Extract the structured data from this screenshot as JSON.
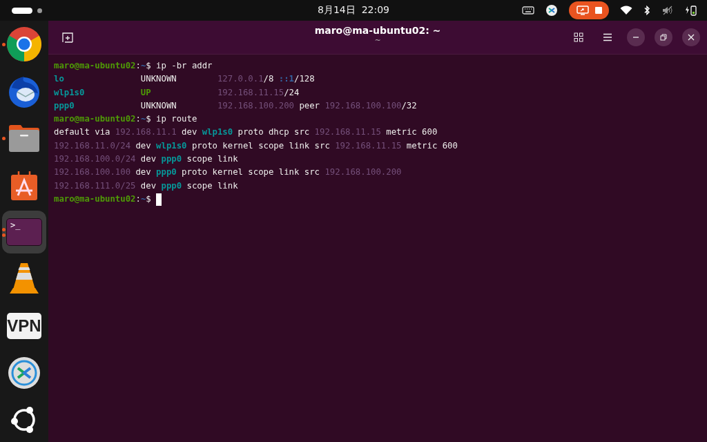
{
  "top_bar": {
    "clock": "8月14日  22:09",
    "recording": true
  },
  "dock": {
    "items": [
      {
        "kind": "chrome",
        "running": true,
        "multiple": false,
        "selected": false
      },
      {
        "kind": "mail",
        "running": false,
        "selected": false
      },
      {
        "kind": "files",
        "running": true,
        "multiple": false,
        "selected": false
      },
      {
        "kind": "store",
        "running": false,
        "selected": false
      },
      {
        "kind": "terminal",
        "running": true,
        "multiple": true,
        "selected": true,
        "icon_text": ">_"
      },
      {
        "kind": "cone",
        "running": false,
        "selected": false
      },
      {
        "kind": "vpn",
        "running": false,
        "selected": false,
        "icon_text": "VPN"
      },
      {
        "kind": "remote",
        "running": false,
        "selected": false
      },
      {
        "kind": "apps",
        "running": false,
        "selected": false
      }
    ]
  },
  "window": {
    "title": "maro@ma-ubuntu02: ~",
    "subtitle": "~"
  },
  "terminal": {
    "lines": [
      [
        {
          "text": "maro@ma-ubuntu02",
          "kind": "user"
        },
        {
          "text": ":",
          "kind": "plain"
        },
        {
          "text": "~",
          "kind": "path"
        },
        {
          "text": "$ ip -br addr",
          "kind": "plain"
        }
      ],
      [
        {
          "text": "lo               ",
          "kind": "iface"
        },
        {
          "text": "UNKNOWN        ",
          "kind": "plain"
        },
        {
          "text": "127.0.0.1",
          "kind": "addr"
        },
        {
          "text": "/8 ",
          "kind": "plain"
        },
        {
          "text": "::1",
          "kind": "addr6"
        },
        {
          "text": "/128",
          "kind": "plain"
        }
      ],
      [
        {
          "text": "wlp1s0           ",
          "kind": "iface"
        },
        {
          "text": "UP             ",
          "kind": "up"
        },
        {
          "text": "192.168.11.15",
          "kind": "addr"
        },
        {
          "text": "/24",
          "kind": "plain"
        }
      ],
      [
        {
          "text": "ppp0             ",
          "kind": "iface"
        },
        {
          "text": "UNKNOWN        ",
          "kind": "plain"
        },
        {
          "text": "192.168.100.200",
          "kind": "addr"
        },
        {
          "text": " peer ",
          "kind": "plain"
        },
        {
          "text": "192.168.100.100",
          "kind": "addr"
        },
        {
          "text": "/32",
          "kind": "plain"
        }
      ],
      [
        {
          "text": "maro@ma-ubuntu02",
          "kind": "user"
        },
        {
          "text": ":",
          "kind": "plain"
        },
        {
          "text": "~",
          "kind": "path"
        },
        {
          "text": "$ ip route",
          "kind": "plain"
        }
      ],
      [
        {
          "text": "default via ",
          "kind": "plain"
        },
        {
          "text": "192.168.11.1",
          "kind": "addr"
        },
        {
          "text": " dev ",
          "kind": "plain"
        },
        {
          "text": "wlp1s0",
          "kind": "iface"
        },
        {
          "text": " proto dhcp src ",
          "kind": "plain"
        },
        {
          "text": "192.168.11.15",
          "kind": "addr"
        },
        {
          "text": " metric 600",
          "kind": "plain"
        }
      ],
      [
        {
          "text": "192.168.11.0/24",
          "kind": "addr"
        },
        {
          "text": " dev ",
          "kind": "plain"
        },
        {
          "text": "wlp1s0",
          "kind": "iface"
        },
        {
          "text": " proto kernel scope link src ",
          "kind": "plain"
        },
        {
          "text": "192.168.11.15",
          "kind": "addr"
        },
        {
          "text": " metric 600",
          "kind": "plain"
        }
      ],
      [
        {
          "text": "192.168.100.0/24",
          "kind": "addr"
        },
        {
          "text": " dev ",
          "kind": "plain"
        },
        {
          "text": "ppp0",
          "kind": "iface"
        },
        {
          "text": " scope link",
          "kind": "plain"
        }
      ],
      [
        {
          "text": "192.168.100.100",
          "kind": "addr"
        },
        {
          "text": " dev ",
          "kind": "plain"
        },
        {
          "text": "ppp0",
          "kind": "iface"
        },
        {
          "text": " proto kernel scope link src ",
          "kind": "plain"
        },
        {
          "text": "192.168.100.200",
          "kind": "addr"
        }
      ],
      [
        {
          "text": "192.168.111.0/25",
          "kind": "addr"
        },
        {
          "text": " dev ",
          "kind": "plain"
        },
        {
          "text": "ppp0",
          "kind": "iface"
        },
        {
          "text": " scope link",
          "kind": "plain"
        }
      ],
      [
        {
          "text": "maro@ma-ubuntu02",
          "kind": "user"
        },
        {
          "text": ":",
          "kind": "plain"
        },
        {
          "text": "~",
          "kind": "path"
        },
        {
          "text": "$ ",
          "kind": "plain"
        }
      ]
    ],
    "cursor": true
  }
}
